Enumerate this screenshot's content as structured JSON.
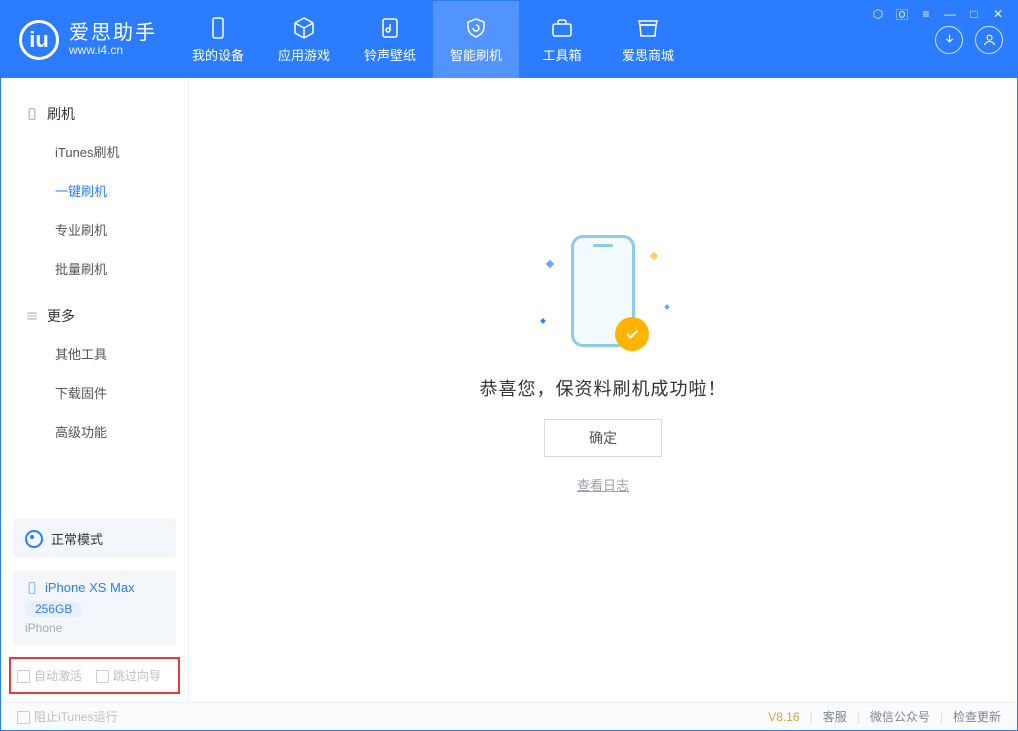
{
  "app": {
    "name": "爱思助手",
    "url": "www.i4.cn"
  },
  "nav": {
    "items": [
      {
        "label": "我的设备"
      },
      {
        "label": "应用游戏"
      },
      {
        "label": "铃声壁纸"
      },
      {
        "label": "智能刷机"
      },
      {
        "label": "工具箱"
      },
      {
        "label": "爱思商城"
      }
    ],
    "active_index": 3
  },
  "sidebar": {
    "section_flash": {
      "title": "刷机",
      "items": [
        "iTunes刷机",
        "一键刷机",
        "专业刷机",
        "批量刷机"
      ],
      "active_index": 1
    },
    "section_more": {
      "title": "更多",
      "items": [
        "其他工具",
        "下载固件",
        "高级功能"
      ]
    },
    "mode_label": "正常模式",
    "device": {
      "name": "iPhone XS Max",
      "storage": "256GB",
      "type": "iPhone"
    },
    "options": {
      "auto_activate": "自动激活",
      "skip_wizard": "跳过向导"
    }
  },
  "main": {
    "success_msg": "恭喜您，保资料刷机成功啦！",
    "ok_btn": "确定",
    "view_log": "查看日志"
  },
  "footer": {
    "block_itunes": "阻止iTunes运行",
    "version": "V8.16",
    "links": [
      "客服",
      "微信公众号",
      "检查更新"
    ]
  }
}
